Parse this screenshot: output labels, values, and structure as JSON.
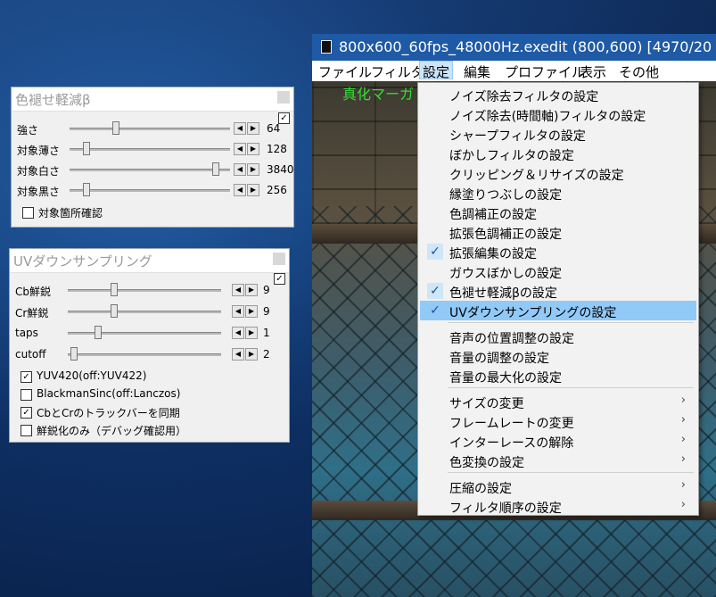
{
  "panel1": {
    "title": "色褪せ軽減β",
    "rows": [
      {
        "label": "強さ",
        "value": "64"
      },
      {
        "label": "対象薄さ",
        "value": "128"
      },
      {
        "label": "対象白さ",
        "value": "3840"
      },
      {
        "label": "対象黒さ",
        "value": "256"
      }
    ],
    "checkbox": {
      "label": "対象箇所確認",
      "checked": false
    },
    "header_check": true
  },
  "panel2": {
    "title": "UVダウンサンプリング",
    "rows": [
      {
        "label": "Cb鮮鋭",
        "value": "9"
      },
      {
        "label": "Cr鮮鋭",
        "value": "9"
      },
      {
        "label": "taps",
        "value": "1"
      },
      {
        "label": "cutoff",
        "value": "2"
      }
    ],
    "checkboxes": [
      {
        "label": "YUV420(off:YUV422)",
        "checked": true,
        "mark": "✓"
      },
      {
        "label": "BlackmanSinc(off:Lanczos)",
        "checked": false,
        "mark": ""
      },
      {
        "label": "CbとCrのトラックバーを同期",
        "checked": true,
        "mark": "✓"
      },
      {
        "label": "鮮鋭化のみ（デバッグ確認用）",
        "checked": false,
        "mark": ""
      }
    ],
    "header_check": true
  },
  "editor": {
    "title": "800x600_60fps_48000Hz.exedit (800,600)  [4970/20",
    "menus": [
      "ファイル",
      "フィルタ",
      "設定",
      "編集",
      "プロファイル",
      "表示",
      "その他"
    ],
    "active_menu": "設定",
    "canvas_text": "真化マーガ"
  },
  "settings_menu": {
    "items": [
      {
        "label": "ノイズ除去フィルタの設定"
      },
      {
        "label": "ノイズ除去(時間軸)フィルタの設定"
      },
      {
        "label": "シャープフィルタの設定"
      },
      {
        "label": "ぼかしフィルタの設定"
      },
      {
        "label": "クリッピング＆リサイズの設定"
      },
      {
        "label": "縁塗りつぶしの設定"
      },
      {
        "label": "色調補正の設定"
      },
      {
        "label": "拡張色調補正の設定"
      },
      {
        "label": "拡張編集の設定",
        "checked": true
      },
      {
        "label": "ガウスぼかしの設定"
      },
      {
        "label": "色褪せ軽減βの設定",
        "checked": true
      },
      {
        "label": "UVダウンサンプリングの設定",
        "checked": true,
        "highlighted": true
      },
      {
        "label": "音声の位置調整の設定"
      },
      {
        "label": "音量の調整の設定"
      },
      {
        "label": "音量の最大化の設定"
      },
      {
        "label": "サイズの変更",
        "submenu": true
      },
      {
        "label": "フレームレートの変更",
        "submenu": true
      },
      {
        "label": "インターレースの解除",
        "submenu": true
      },
      {
        "label": "色変換の設定",
        "submenu": true
      },
      {
        "label": "圧縮の設定",
        "submenu": true
      },
      {
        "label": "フィルタ順序の設定",
        "submenu": true
      }
    ],
    "check_glyph": "✓",
    "submenu_glyph": "›"
  },
  "colors": {
    "highlight": "#91c9f7",
    "check_bg": "#cfe6f8",
    "desktop": "#0e2f63"
  }
}
